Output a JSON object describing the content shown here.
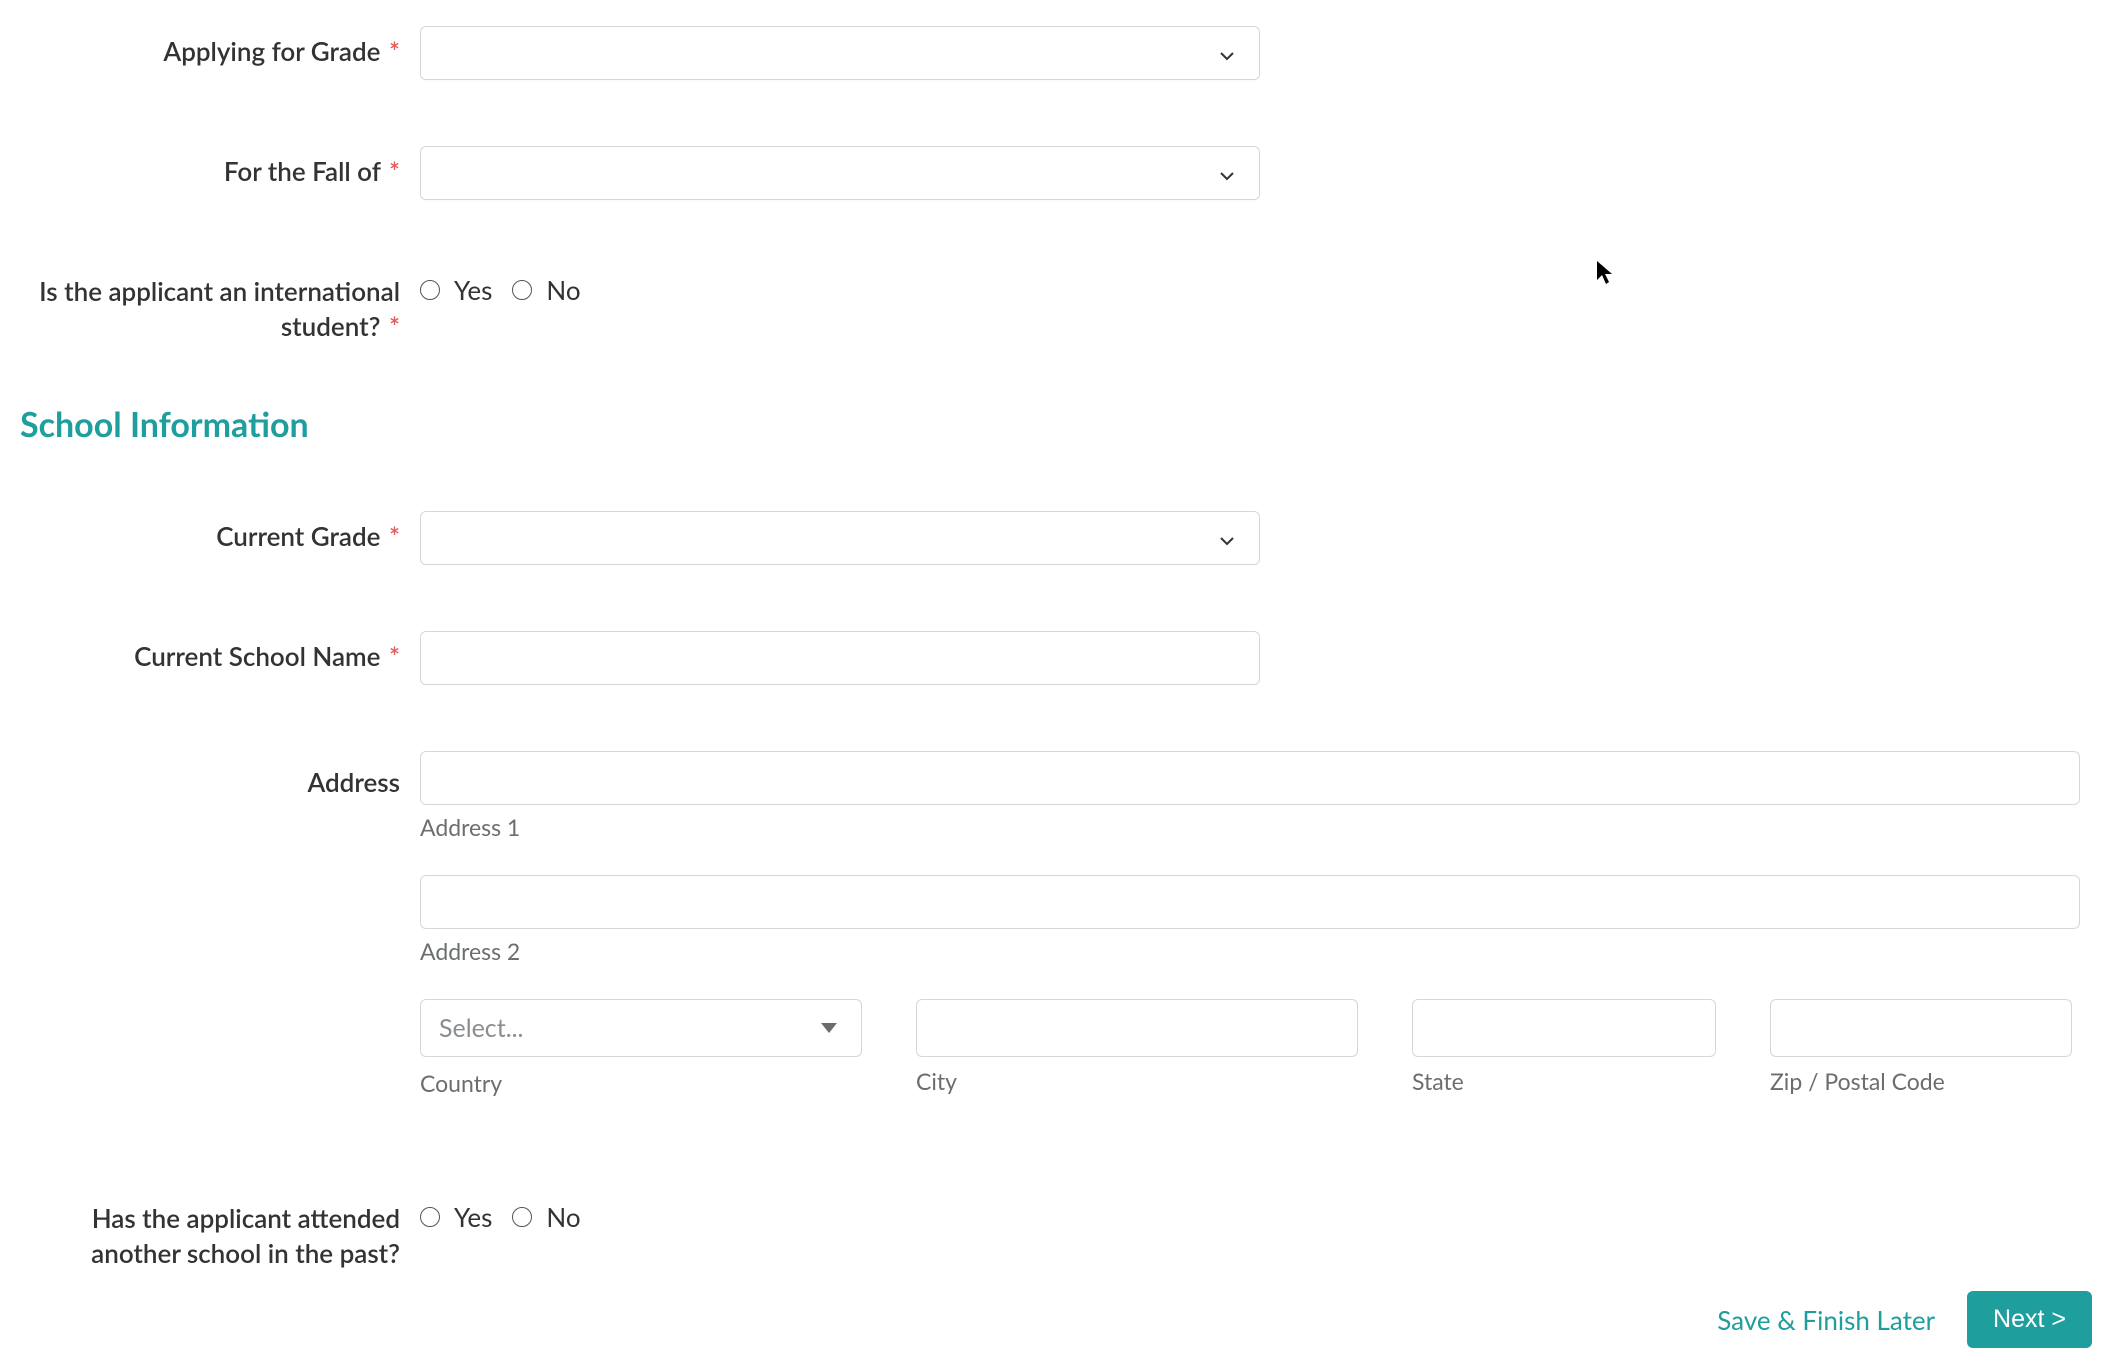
{
  "fields": {
    "applying_grade": {
      "label": "Applying for Grade",
      "required": true
    },
    "fall_of": {
      "label": "For the Fall of",
      "required": true
    },
    "intl": {
      "label": "Is the applicant an international student?",
      "required": true,
      "yes": "Yes",
      "no": "No"
    }
  },
  "section_school": "School Information",
  "school": {
    "current_grade": {
      "label": "Current Grade",
      "required": true
    },
    "school_name": {
      "label": "Current School Name",
      "required": true
    },
    "address": {
      "label": "Address",
      "line1_sub": "Address 1",
      "line2_sub": "Address 2",
      "country": {
        "sub": "Country",
        "placeholder": "Select..."
      },
      "city": {
        "sub": "City"
      },
      "state": {
        "sub": "State"
      },
      "zip": {
        "sub": "Zip / Postal Code"
      }
    },
    "attended_other": {
      "label": "Has the applicant attended another school in the past?",
      "yes": "Yes",
      "no": "No"
    }
  },
  "footer": {
    "save": "Save & Finish Later",
    "next": "Next >"
  },
  "asterisk": "*"
}
